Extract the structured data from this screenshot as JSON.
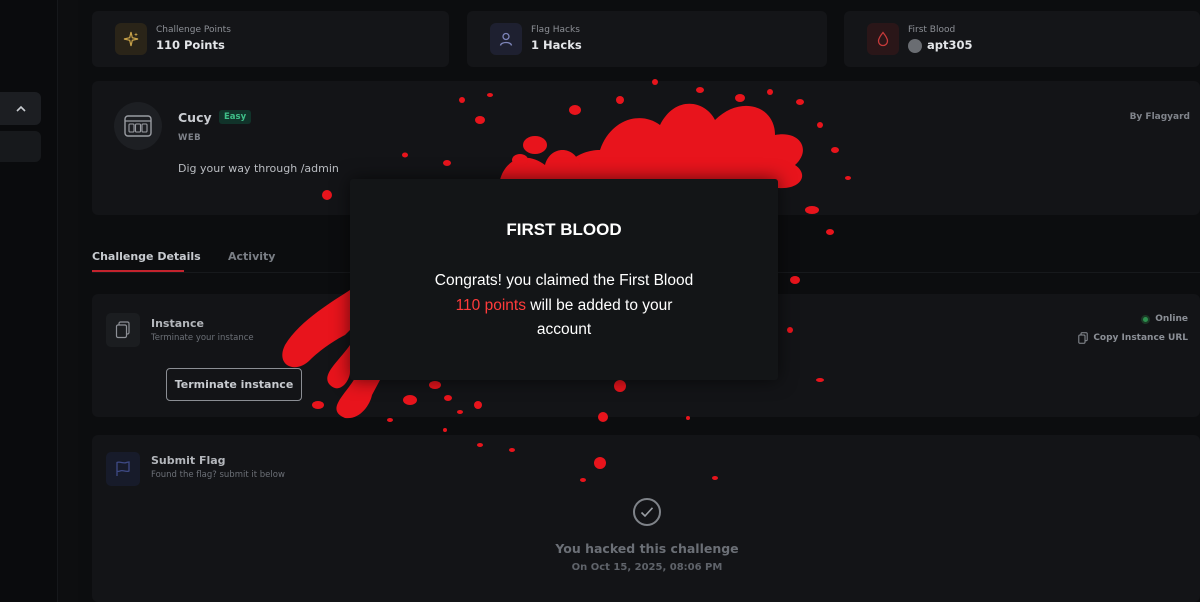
{
  "stats": [
    {
      "label": "Challenge Points",
      "value": "110 Points",
      "icon": "sparkle-icon",
      "color": "#c8a24a"
    },
    {
      "label": "Flag Hacks",
      "value": "1 Hacks",
      "icon": "user-icon",
      "color": "#7d84b8"
    },
    {
      "label": "First Blood",
      "value": "apt305",
      "icon": "blood-drop-icon",
      "color": "#c63a3a"
    }
  ],
  "challenge": {
    "name": "Cucy",
    "difficulty": "Easy",
    "category": "WEB",
    "description": "Dig your way through /admin",
    "author": "By Flagyard"
  },
  "tabs": [
    {
      "label": "Challenge Details",
      "active": true
    },
    {
      "label": "Activity",
      "active": false
    }
  ],
  "instance": {
    "title": "Instance",
    "subtitle": "Terminate your instance",
    "button": "Terminate instance",
    "status": "Online",
    "copy_label": "Copy Instance URL"
  },
  "submit": {
    "title": "Submit Flag",
    "subtitle": "Found the flag? submit it below",
    "hacked_text": "You hacked this challenge",
    "hacked_date": "On Oct 15, 2025, 08:06 PM"
  },
  "modal": {
    "title": "FIRST BLOOD",
    "line1": "Congrats! you claimed the First Blood",
    "points": "110 points",
    "line2_rest": " will be added to your",
    "line3": "account",
    "splash_color": "#e8141c"
  }
}
